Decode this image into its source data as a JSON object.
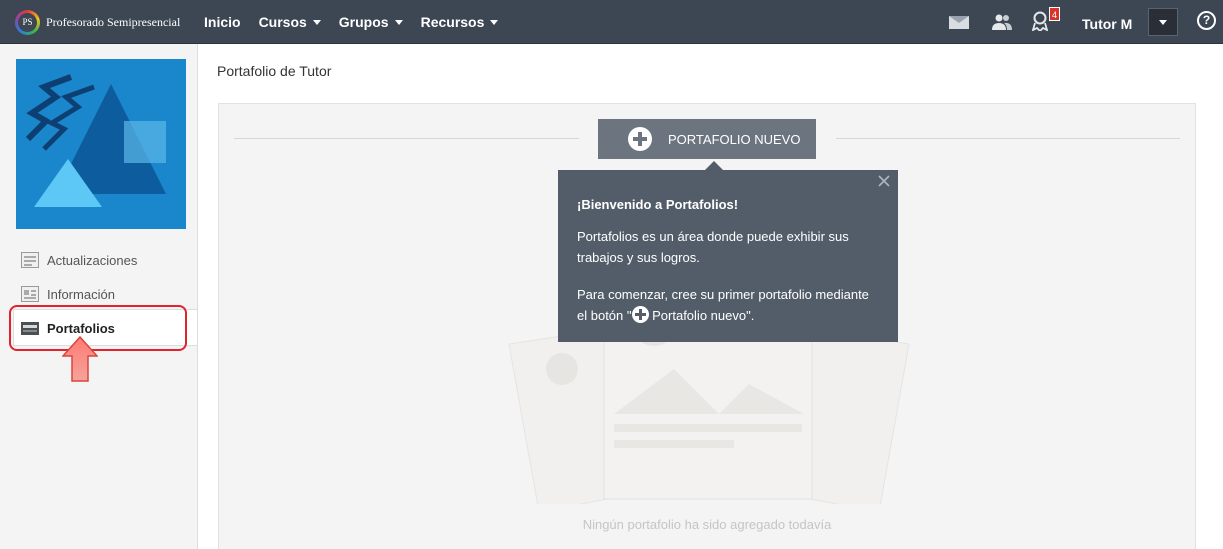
{
  "brand": {
    "logo_text": "PS",
    "name": "Profesorado Semipresencial"
  },
  "nav": [
    {
      "label": "Inicio",
      "dropdown": false
    },
    {
      "label": "Cursos",
      "dropdown": true
    },
    {
      "label": "Grupos",
      "dropdown": true
    },
    {
      "label": "Recursos",
      "dropdown": true
    }
  ],
  "header": {
    "notification_count": "4",
    "user_name": "Tutor M",
    "help_label": "?"
  },
  "sidebar": {
    "items": [
      {
        "label": "Actualizaciones",
        "icon": "updates-icon"
      },
      {
        "label": "Información",
        "icon": "info-card-icon"
      },
      {
        "label": "Portafolios",
        "icon": "portfolio-icon",
        "active": true
      }
    ]
  },
  "main": {
    "page_title": "Portafolio de Tutor",
    "new_button_label": "PORTAFOLIO NUEVO",
    "empty_message": "Ningún portafolio ha sido agregado todavía"
  },
  "tooltip": {
    "title": "¡Bienvenido a Portafolios!",
    "p1": "Portafolios es un área donde puede exhibir sus trabajos y sus logros.",
    "p2_before": "Para comenzar, cree su primer portafolio mediante el botón \"",
    "p2_button": "Portafolio nuevo",
    "p2_after": "\"."
  },
  "colors": {
    "topbar": "#3d4653",
    "accent_blue": "#1a87cc",
    "highlight_red": "#e0232f",
    "badge_red": "#d9342b"
  }
}
